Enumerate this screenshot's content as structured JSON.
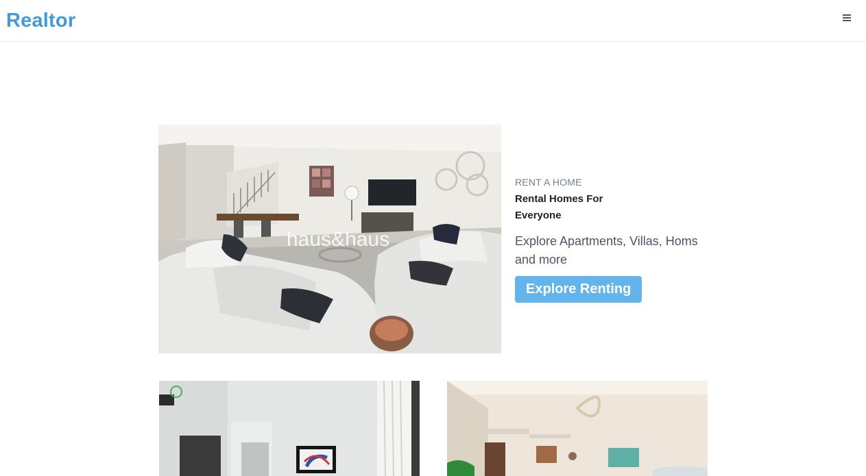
{
  "header": {
    "logo": "Realtor",
    "menu_icon": "hamburger-menu-icon"
  },
  "hero": {
    "eyebrow": "RENT A HOME",
    "title": "Rental Homes For Everyone",
    "description": "Explore Apartments, Villas, Homs and more",
    "button_label": "Explore Renting",
    "image_watermark": "haus&haus"
  },
  "colors": {
    "brand": "#4299e1",
    "button": "#63b3ed"
  },
  "listings": [
    {
      "image": "apartment-interior-photo"
    },
    {
      "image": "apartment-living-room-photo"
    }
  ]
}
